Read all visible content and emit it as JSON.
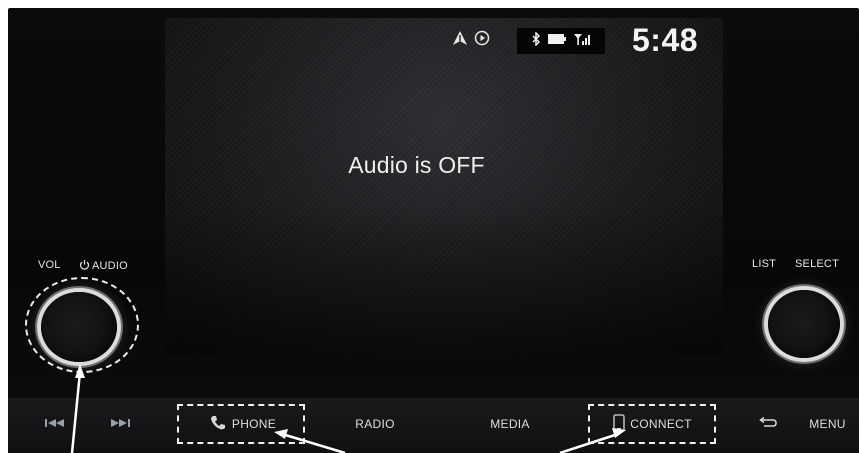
{
  "status_bar": {
    "nav_icons": [
      "navigation-arrow-icon",
      "play-circle-icon"
    ],
    "connectivity_icons": [
      "bluetooth-icon",
      "battery-icon",
      "signal-icon"
    ],
    "time": "5:48"
  },
  "main": {
    "message": "Audio is OFF"
  },
  "left_knob": {
    "vol_label": "VOL",
    "power_audio_label": "AUDIO"
  },
  "right_knob": {
    "list_label": "LIST",
    "select_label": "SELECT"
  },
  "bottom_bar": {
    "prev_icon": "seek-back-icon",
    "next_icon": "seek-forward-icon",
    "phone_label": "PHONE",
    "radio_label": "RADIO",
    "media_label": "MEDIA",
    "connect_label": "CONNECT",
    "back_icon": "back-arrow-icon",
    "menu_label": "MENU"
  },
  "colors": {
    "bezel": "#0b0b0c",
    "text": "#efefef",
    "highlight": "#ffffff"
  }
}
